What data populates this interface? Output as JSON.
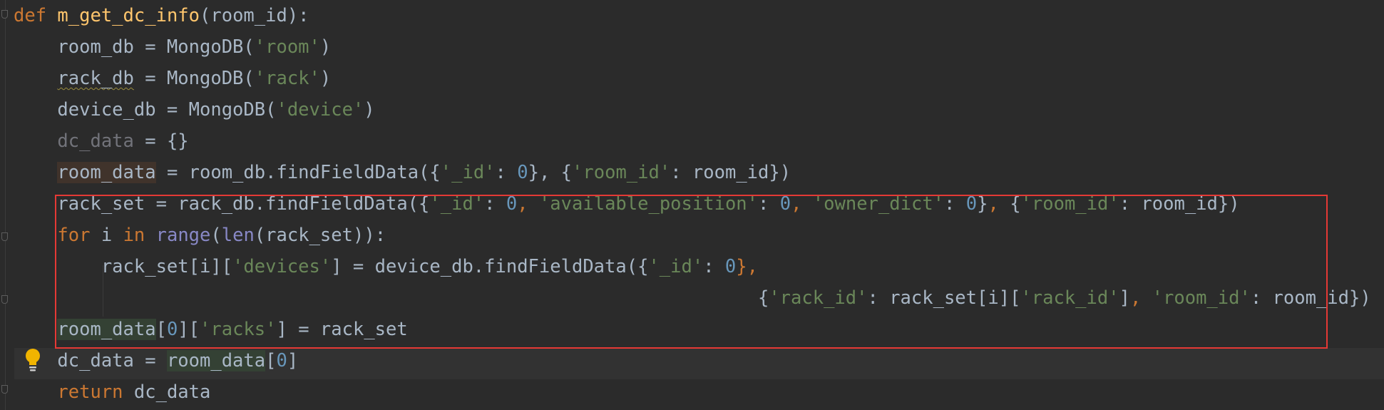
{
  "code_lines": [
    {
      "tokens": [
        {
          "t": "def ",
          "c": "kw"
        },
        {
          "t": "m_get_dc_info",
          "c": "fn"
        },
        {
          "t": "(room_id):",
          "c": "pl"
        }
      ]
    },
    {
      "tokens": [
        {
          "t": "    room_db = MongoDB(",
          "c": "pl"
        },
        {
          "t": "'room'",
          "c": "str"
        },
        {
          "t": ")",
          "c": "pl"
        }
      ]
    },
    {
      "tokens": [
        {
          "t": "    ",
          "c": "pl"
        },
        {
          "t": "rack_db",
          "c": "pl squiggle"
        },
        {
          "t": " = MongoDB(",
          "c": "pl"
        },
        {
          "t": "'rack'",
          "c": "str"
        },
        {
          "t": ")",
          "c": "pl"
        }
      ]
    },
    {
      "tokens": [
        {
          "t": "    device_db = MongoDB(",
          "c": "pl"
        },
        {
          "t": "'device'",
          "c": "str"
        },
        {
          "t": ")",
          "c": "pl"
        }
      ]
    },
    {
      "tokens": [
        {
          "t": "    ",
          "c": "pl"
        },
        {
          "t": "dc_data",
          "c": "dim"
        },
        {
          "t": " = {}",
          "c": "pl"
        }
      ]
    },
    {
      "tokens": [
        {
          "t": "    ",
          "c": "pl"
        },
        {
          "t": "room_data",
          "c": "pl hl-write"
        },
        {
          "t": " = room_db.findFieldData({",
          "c": "pl"
        },
        {
          "t": "'_id'",
          "c": "str"
        },
        {
          "t": ": ",
          "c": "pl"
        },
        {
          "t": "0",
          "c": "num"
        },
        {
          "t": "}, {",
          "c": "pl"
        },
        {
          "t": "'room_id'",
          "c": "str"
        },
        {
          "t": ": room_id})",
          "c": "pl"
        }
      ]
    },
    {
      "tokens": [
        {
          "t": "    rack_set = rack_db.findFieldData({",
          "c": "pl"
        },
        {
          "t": "'_id'",
          "c": "str"
        },
        {
          "t": ": ",
          "c": "pl"
        },
        {
          "t": "0",
          "c": "num"
        },
        {
          "t": ", ",
          "c": "kw"
        },
        {
          "t": "'available_position'",
          "c": "str"
        },
        {
          "t": ": ",
          "c": "pl"
        },
        {
          "t": "0",
          "c": "num"
        },
        {
          "t": ", ",
          "c": "kw"
        },
        {
          "t": "'owner_dict'",
          "c": "str"
        },
        {
          "t": ": ",
          "c": "pl"
        },
        {
          "t": "0",
          "c": "num"
        },
        {
          "t": "}",
          "c": "pl"
        },
        {
          "t": ", ",
          "c": "kw"
        },
        {
          "t": "{",
          "c": "pl"
        },
        {
          "t": "'room_id'",
          "c": "str"
        },
        {
          "t": ": room_id})",
          "c": "pl"
        }
      ]
    },
    {
      "tokens": [
        {
          "t": "    ",
          "c": "pl"
        },
        {
          "t": "for ",
          "c": "kw"
        },
        {
          "t": "i ",
          "c": "pl"
        },
        {
          "t": "in ",
          "c": "kw"
        },
        {
          "t": "range",
          "c": "bi"
        },
        {
          "t": "(",
          "c": "pl"
        },
        {
          "t": "len",
          "c": "bi"
        },
        {
          "t": "(rack_set)):",
          "c": "pl"
        }
      ]
    },
    {
      "tokens": [
        {
          "t": "        rack_set[i][",
          "c": "pl"
        },
        {
          "t": "'devices'",
          "c": "str"
        },
        {
          "t": "] = device_db.findFieldData({",
          "c": "pl"
        },
        {
          "t": "'_id'",
          "c": "str"
        },
        {
          "t": ": ",
          "c": "pl"
        },
        {
          "t": "0",
          "c": "num"
        },
        {
          "t": "},",
          "c": "kw"
        }
      ]
    },
    {
      "tokens": [
        {
          "t": "                                                                    {",
          "c": "pl"
        },
        {
          "t": "'rack_id'",
          "c": "str"
        },
        {
          "t": ": rack_set[i][",
          "c": "pl"
        },
        {
          "t": "'rack_id'",
          "c": "str"
        },
        {
          "t": "]",
          "c": "pl"
        },
        {
          "t": ", ",
          "c": "kw"
        },
        {
          "t": "'room_id'",
          "c": "str"
        },
        {
          "t": ": room_id})",
          "c": "pl"
        }
      ]
    },
    {
      "tokens": [
        {
          "t": "    ",
          "c": "pl"
        },
        {
          "t": "room_data",
          "c": "pl hl-read"
        },
        {
          "t": "[",
          "c": "pl"
        },
        {
          "t": "0",
          "c": "num"
        },
        {
          "t": "][",
          "c": "pl"
        },
        {
          "t": "'racks'",
          "c": "str"
        },
        {
          "t": "] = rack_set",
          "c": "pl"
        }
      ]
    },
    {
      "tokens": [
        {
          "t": "    dc_data = ",
          "c": "pl"
        },
        {
          "t": "room_data",
          "c": "pl hl-read"
        },
        {
          "t": "[",
          "c": "pl"
        },
        {
          "t": "0",
          "c": "num"
        },
        {
          "t": "]",
          "c": "pl"
        }
      ]
    },
    {
      "tokens": [
        {
          "t": "    ",
          "c": "pl"
        },
        {
          "t": "return ",
          "c": "kw"
        },
        {
          "t": "dc_data",
          "c": "pl"
        }
      ]
    }
  ],
  "colors": {
    "background": "#2b2b2b",
    "keyword": "#cc7832",
    "function": "#ffc66d",
    "string": "#6a8759",
    "number": "#6897bb",
    "builtin": "#8888c6",
    "plain": "#a9b7c6",
    "highlight_box": "#e53935",
    "bulb": "#f0b400"
  },
  "icons": {
    "intention": "lightbulb-icon",
    "fold": "fold-marker-icon"
  }
}
